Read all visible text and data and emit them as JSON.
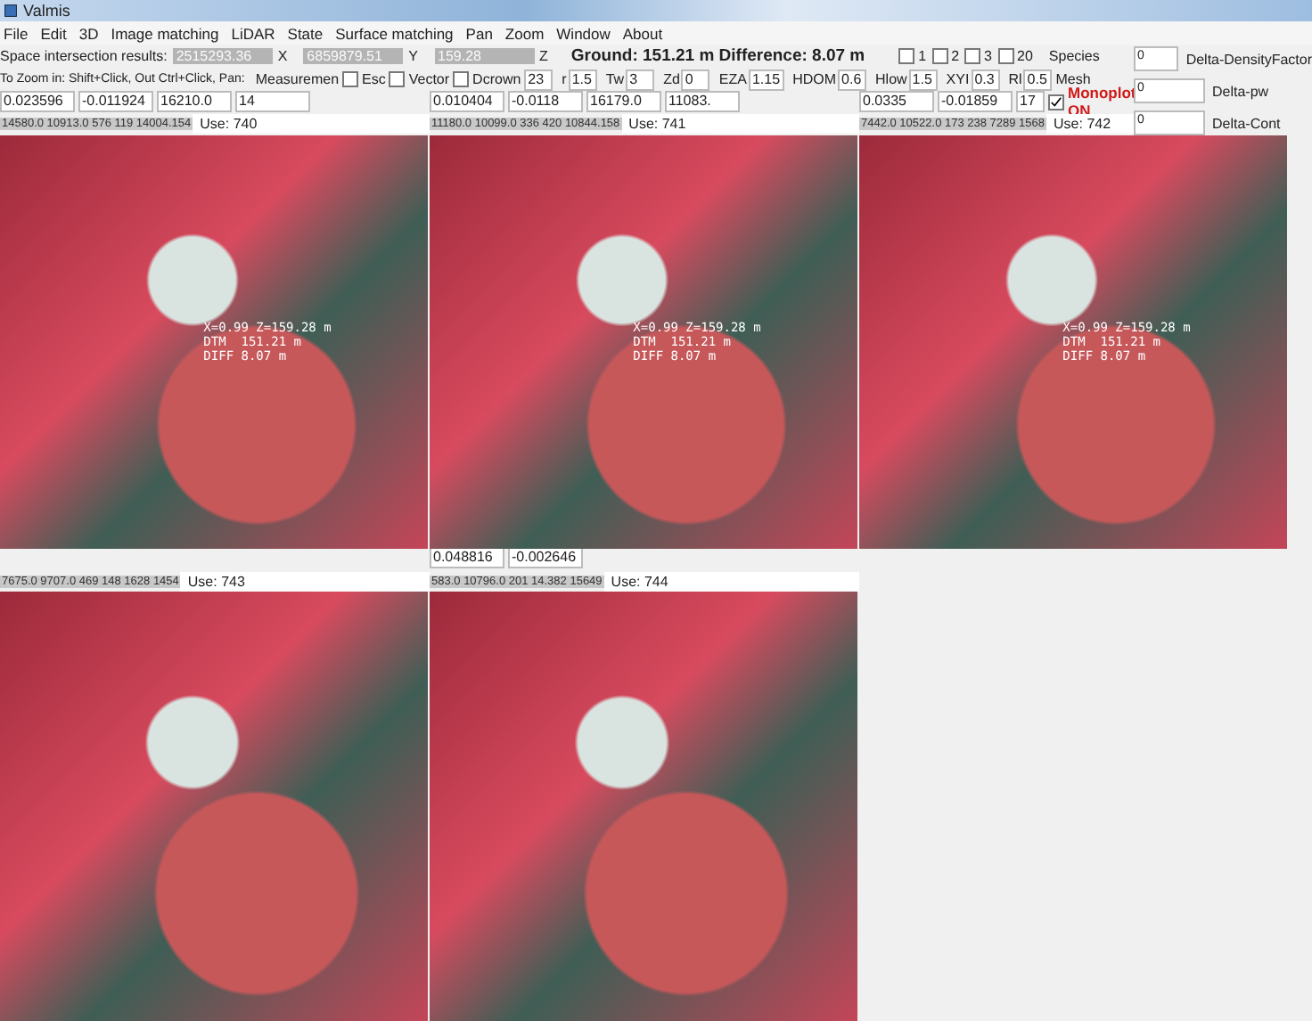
{
  "window": {
    "title": "Valmis"
  },
  "menu": [
    "File",
    "Edit",
    "3D",
    "Image matching",
    "LiDAR",
    "State",
    "Surface matching",
    "Pan",
    "Zoom",
    "Window",
    "About"
  ],
  "intersection": {
    "label": "Space intersection results:",
    "values": [
      {
        "value": "2515293.36",
        "axis": "X"
      },
      {
        "value": "6859879.51",
        "axis": "Y"
      },
      {
        "value": "159.28",
        "axis": "Z"
      }
    ],
    "summary": "Ground: 151.21 m Difference: 8.07 m"
  },
  "image_checks": [
    {
      "label": "1",
      "checked": false
    },
    {
      "label": "2",
      "checked": false
    },
    {
      "label": "3",
      "checked": false
    },
    {
      "label": "20",
      "checked": false
    }
  ],
  "species_label": "Species",
  "zoom_hint": "To Zoom in: Shift+Click, Out Ctrl+Click, Pan:",
  "measurement_label": "Measuremen",
  "options": [
    {
      "label": "Esc",
      "checked": false
    },
    {
      "label": "Vector",
      "checked": false
    },
    {
      "label": "Dcrown",
      "checked": false,
      "value": "23"
    }
  ],
  "params": [
    {
      "label": "r",
      "value": "1.5"
    },
    {
      "label": "Tw",
      "value": "3"
    },
    {
      "label": "Zd",
      "value": "0"
    },
    {
      "label": "EZA",
      "value": "1.15"
    },
    {
      "label": "HDOM",
      "value": "0.6"
    },
    {
      "label": "Hlow",
      "value": "1.5"
    },
    {
      "label": "XYI",
      "value": "0.3"
    },
    {
      "label": "Rl",
      "value": "0.5"
    }
  ],
  "mesh_label": "Mesh",
  "monoplot": {
    "value": "17",
    "checked": true,
    "label": "Monoplot ON"
  },
  "deltas": [
    {
      "value": "0",
      "label": "Delta-DensityFactor"
    },
    {
      "value": "0",
      "label": "Delta-pw"
    },
    {
      "value": "0",
      "label": "Delta-Cont"
    }
  ],
  "panels": [
    {
      "fields": [
        "0.023596",
        "-0.011924",
        "16210.0",
        "14"
      ],
      "info": "14580.0 10913.0 576 119 14004.154",
      "use": "Use: 740",
      "overlay": [
        "X=0.99 Z=159.28 m",
        "DTM  151.21 m",
        "DIFF 8.07 m"
      ]
    },
    {
      "fields": [
        "0.010404",
        "-0.0118",
        "16179.0",
        "11083."
      ],
      "info": "11180.0 10099.0 336 420 10844.158",
      "use": "Use: 741",
      "overlay": [
        "X=0.99 Z=159.28 m",
        "DTM  151.21 m",
        "DIFF 8.07 m"
      ]
    },
    {
      "fields": [
        "0.0335",
        "-0.01859"
      ],
      "info": "7442.0 10522.0 173 238 7289 1568",
      "use": "Use: 742",
      "overlay": [
        "X=0.99 Z=159.28 m",
        "DTM  151.21 m",
        "DIFF 8.07 m"
      ]
    },
    {
      "info": "7675.0 9707.0 469 148 1628 1454",
      "use": "Use: 743"
    },
    {
      "fields": [
        "0.048816",
        "-0.002646"
      ],
      "info": "583.0 10796.0 201 14.382 15649",
      "use": "Use: 744"
    }
  ]
}
